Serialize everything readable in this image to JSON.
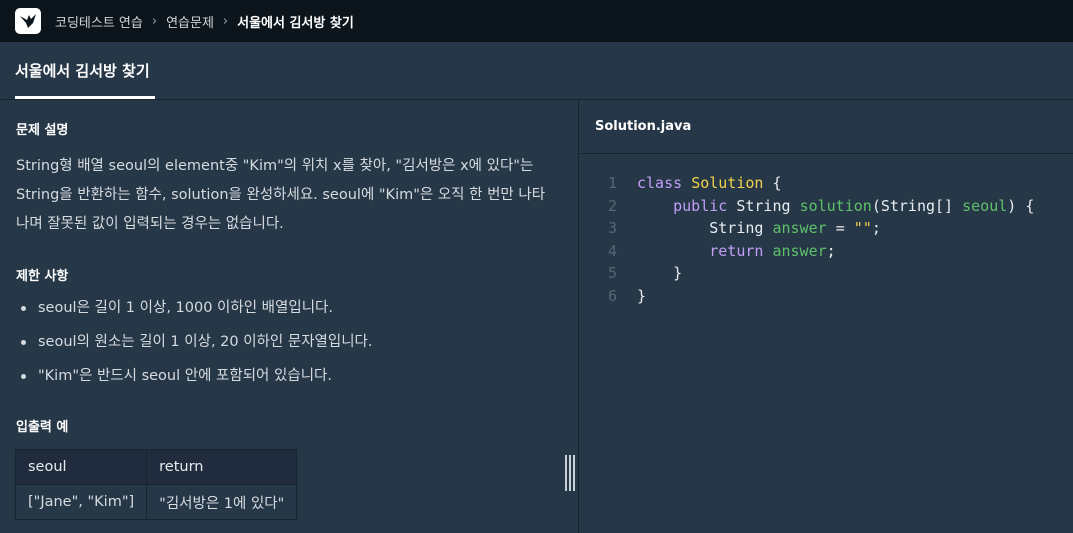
{
  "breadcrumb": [
    "코딩테스트 연습",
    "연습문제",
    "서울에서 김서방 찾기"
  ],
  "tab": {
    "label": "서울에서 김서방 찾기"
  },
  "description": {
    "title": "문제 설명",
    "text": "String형 배열 seoul의 element중 \"Kim\"의 위치 x를 찾아, \"김서방은 x에 있다\"는 String을 반환하는 함수, solution을 완성하세요. seoul에 \"Kim\"은 오직 한 번만 나타나며 잘못된 값이 입력되는 경우는 없습니다."
  },
  "constraints": {
    "title": "제한 사항",
    "items": [
      "seoul은 길이 1 이상, 1000 이하인 배열입니다.",
      "seoul의 원소는 길이 1 이상, 20 이하인 문자열입니다.",
      "\"Kim\"은 반드시 seoul 안에 포함되어 있습니다."
    ]
  },
  "examples": {
    "title": "입출력 예",
    "headers": [
      "seoul",
      "return"
    ],
    "rows": [
      [
        "[\"Jane\", \"Kim\"]",
        "\"김서방은 1에 있다\""
      ]
    ]
  },
  "editor": {
    "filename": "Solution.java",
    "line_numbers": [
      "1",
      "2",
      "3",
      "4",
      "5",
      "6"
    ],
    "code": {
      "l1": {
        "kw": "class",
        "cls": "Solution",
        "brace": "{"
      },
      "l2": {
        "kw": "public",
        "type": "String",
        "fn": "solution",
        "open": "(",
        "param_type": "String[]",
        "param": "seoul",
        "close": ")",
        "brace": "{"
      },
      "l3": {
        "type": "String",
        "var": "answer",
        "op": "=",
        "str": "\"\"",
        "semi": ";"
      },
      "l4": {
        "kw": "return",
        "var": "answer",
        "semi": ";"
      },
      "l5": {
        "brace": "}"
      },
      "l6": {
        "brace": "}"
      }
    }
  },
  "colors": {
    "background": "#263747",
    "topbar": "#0c151c",
    "keyword": "#c39ef7",
    "class_name": "#f2d24b",
    "function": "#5ec16a",
    "string": "#f2d24b"
  }
}
